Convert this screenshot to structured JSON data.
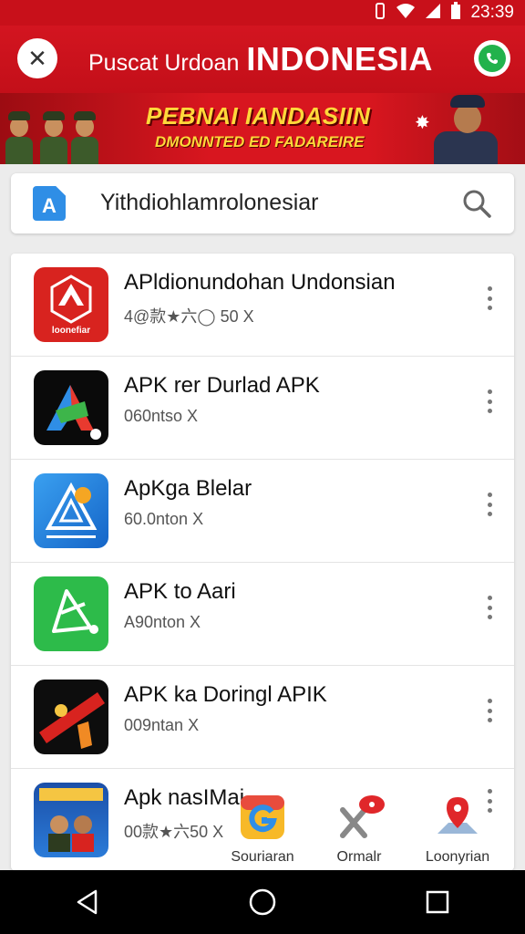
{
  "status_bar": {
    "time": "23:39"
  },
  "header": {
    "title_small": "Puscat Urdoan",
    "title_big": "INDONESIA"
  },
  "banner": {
    "line1": "PEBNAI IANDASIIN",
    "line2": "DMONNTED ED FADAREIRE"
  },
  "search": {
    "query": "Yithdiohlamrolonesiar",
    "icon_letter": "A"
  },
  "apps": [
    {
      "title": "APldionundohan Undonsian",
      "subtitle": "4@款★六◯ 50 X",
      "icon": "red-emblem-icon",
      "icon_text": "loonefiar"
    },
    {
      "title": "APK rer Durlad APK",
      "subtitle": "060ntso X",
      "icon": "black-green-a-icon"
    },
    {
      "title": "ApKga Blelar",
      "subtitle": "60.0nton X",
      "icon": "blue-triangle-icon"
    },
    {
      "title": "APK to Aari",
      "subtitle": "A90nton X",
      "icon": "green-shape-icon"
    },
    {
      "title": "APK ka Doringl APIK",
      "subtitle": "009ntan X",
      "icon": "black-red-banner-icon"
    },
    {
      "title": "Apk nasIMai",
      "subtitle": "00款★六50 X",
      "icon": "poster-icon"
    }
  ],
  "shortcuts": [
    {
      "label": "Souriaran",
      "icon": "g-app-icon"
    },
    {
      "label": "Ormalr",
      "icon": "x-notification-icon"
    },
    {
      "label": "Loonyrian",
      "icon": "map-pin-icon"
    }
  ],
  "colors": {
    "header_red": "#c8101a",
    "banner_yellow": "#ffd83a",
    "accent_green": "#22b24c",
    "accent_blue": "#2f8ee6"
  }
}
